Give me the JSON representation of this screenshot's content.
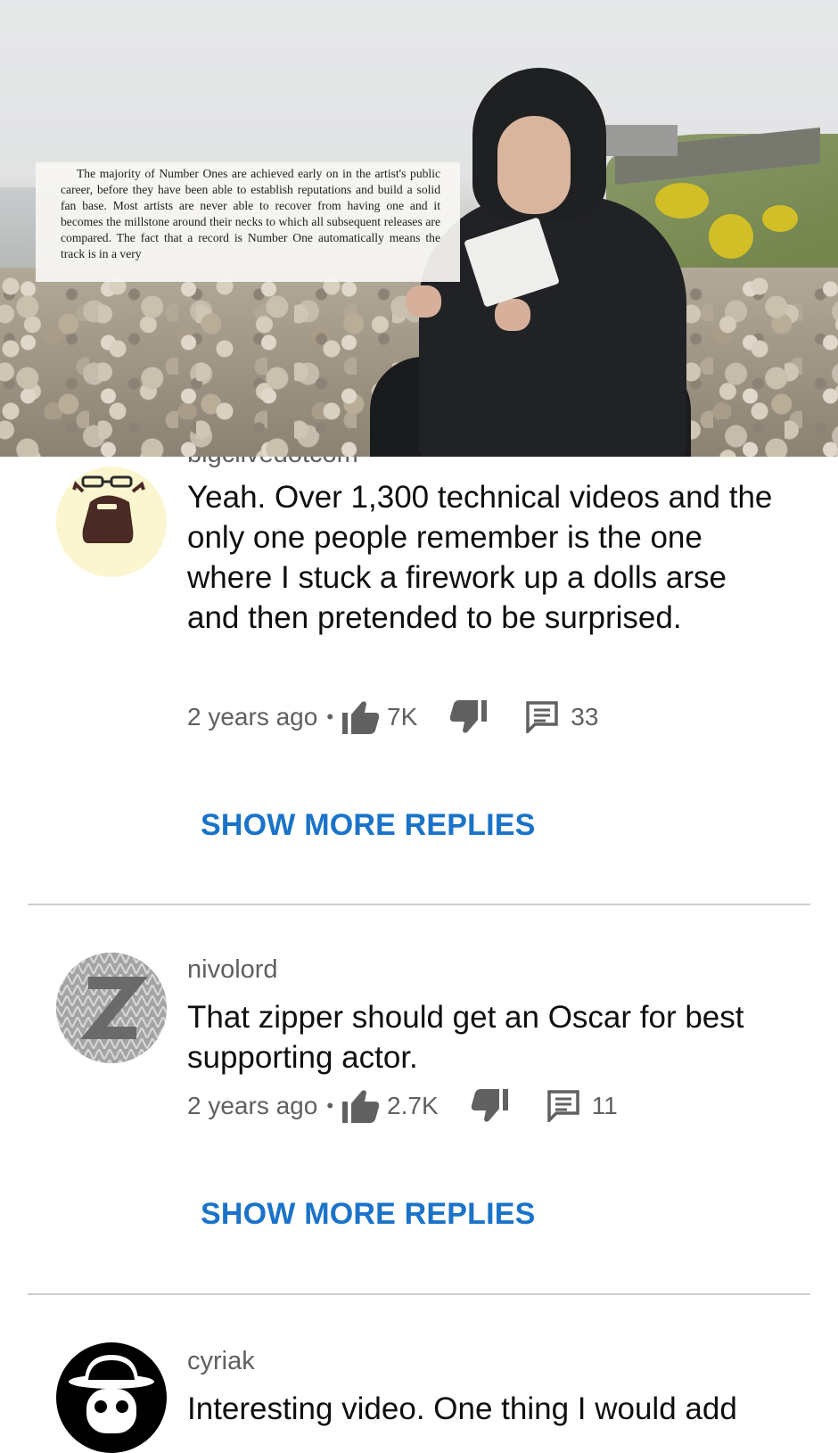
{
  "video": {
    "book_excerpt": "The majority of Number Ones are achieved early on in the artist's public career, before they have been able to establish reputations and build a solid fan base. Most artists are never able to recover from having one and it becomes the millstone around their necks to which all subsequent releases are compared. The fact that a record is Number One automatically means the track is in a very"
  },
  "comments": [
    {
      "author": "bigclivedotcom",
      "text": "Yeah.  Over 1,300 technical videos and the only one people remember is the one where I stuck a firework up a dolls arse and then pretended to be surprised.",
      "time": "2 years ago",
      "likes": "7K",
      "replies": "33",
      "avatar_icon": "bearded-man-avatar-icon",
      "show_more": "SHOW MORE REPLIES"
    },
    {
      "author": "nivolord",
      "text": "That zipper should get an Oscar for best supporting actor.",
      "time": "2 years ago",
      "likes": "2.7K",
      "replies": "11",
      "avatar_icon": "knit-pattern-avatar-icon",
      "show_more": "SHOW MORE REPLIES"
    },
    {
      "author": "cyriak",
      "text": "Interesting video. One thing I would add",
      "avatar_icon": "bowler-hat-skull-avatar-icon"
    }
  ],
  "icons": {
    "like": "thumbs-up-icon",
    "dislike": "thumbs-down-icon",
    "reply": "comment-icon"
  },
  "colors": {
    "link_blue": "#1a73c8",
    "meta_gray": "#606060",
    "avatar_bg_yellow": "#fbf6cf"
  }
}
